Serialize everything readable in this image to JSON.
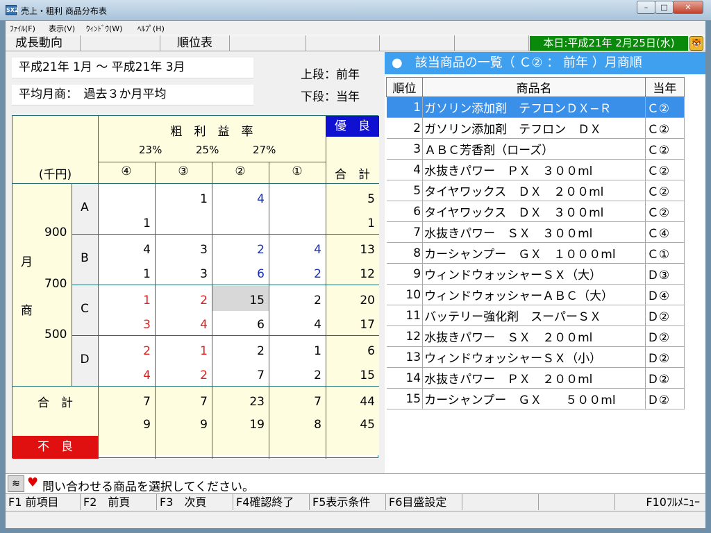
{
  "window": {
    "app_icon": "SX2",
    "title": "売上・粗利 商品分布表",
    "minimize_icon": "–",
    "maximize_icon": "□",
    "close_icon": "✕"
  },
  "menu": [
    "ﾌｧｲﾙ(F)",
    "表示(V)",
    "ｳｨﾝﾄﾞｳ(W)",
    "ﾍﾙﾌﾟ(H)"
  ],
  "toolbar": {
    "growth": "成長動向",
    "ranking": "順位表",
    "date": "本日:平成21年 2月25日(水)",
    "tiger_icon": "🐯"
  },
  "left": {
    "period": "平成21年 1月 〜 平成21年 3月",
    "avg_label": "平均月商：　過去３か月平均",
    "upper": "上段：前年",
    "lower": "下段：当年"
  },
  "matrix": {
    "title": "粗　利　益　率",
    "pcts": [
      "23%",
      "25%",
      "27%"
    ],
    "cols": [
      "④",
      "③",
      "②",
      "①"
    ],
    "unit": "(千円)",
    "excellent": "優　良",
    "total": "合　計",
    "poor": "不　良",
    "month_char": "月",
    "sales_char": "商",
    "row_totals_label": "合　計",
    "y_ticks": [
      "900",
      "700",
      "500"
    ],
    "rows": [
      {
        "label": "A",
        "cells": [
          {
            "top": "",
            "bot": "1"
          },
          {
            "top": "1",
            "bot": ""
          },
          {
            "top": "4",
            "bot": ""
          },
          {
            "top": "",
            "bot": ""
          }
        ],
        "sum": {
          "top": "5",
          "bot": "1"
        }
      },
      {
        "label": "B",
        "cells": [
          {
            "top": "4",
            "bot": "1"
          },
          {
            "top": "3",
            "bot": "3"
          },
          {
            "top": "2",
            "bot": "6"
          },
          {
            "top": "4",
            "bot": "2"
          }
        ],
        "sum": {
          "top": "13",
          "bot": "12"
        }
      },
      {
        "label": "C",
        "cells": [
          {
            "top": "1",
            "bot": "3"
          },
          {
            "top": "2",
            "bot": "4"
          },
          {
            "top": "15",
            "bot": "6"
          },
          {
            "top": "2",
            "bot": "4"
          }
        ],
        "sum": {
          "top": "20",
          "bot": "17"
        }
      },
      {
        "label": "D",
        "cells": [
          {
            "top": "2",
            "bot": "4"
          },
          {
            "top": "1",
            "bot": "2"
          },
          {
            "top": "2",
            "bot": "7"
          },
          {
            "top": "1",
            "bot": "2"
          }
        ],
        "sum": {
          "top": "6",
          "bot": "15"
        }
      }
    ],
    "col_totals": [
      {
        "top": "7",
        "bot": "9"
      },
      {
        "top": "7",
        "bot": "9"
      },
      {
        "top": "23",
        "bot": "19"
      },
      {
        "top": "7",
        "bot": "8"
      }
    ],
    "grand_total": {
      "top": "44",
      "bot": "45"
    }
  },
  "list": {
    "header": "●　該当商品の一覧（ Ｃ② ： 前年 ）月商順",
    "col_rank": "順位",
    "col_name": "商品名",
    "col_grade": "当年",
    "items": [
      {
        "rank": "1",
        "name": "ガソリン添加剤　テフロンＤＸ−Ｒ",
        "grade": "Ｃ②"
      },
      {
        "rank": "2",
        "name": "ガソリン添加剤　テフロン　ＤＸ",
        "grade": "Ｃ②"
      },
      {
        "rank": "3",
        "name": "ＡＢＣ芳香剤（ローズ）",
        "grade": "Ｃ②"
      },
      {
        "rank": "4",
        "name": "水抜きパワー　ＰＸ　３００ml",
        "grade": "Ｃ②"
      },
      {
        "rank": "5",
        "name": "タイヤワックス　ＤＸ　２００ml",
        "grade": "Ｃ②"
      },
      {
        "rank": "6",
        "name": "タイヤワックス　ＤＸ　３００ml",
        "grade": "Ｃ②"
      },
      {
        "rank": "7",
        "name": "水抜きパワー　ＳＸ　３００ml",
        "grade": "Ｃ④"
      },
      {
        "rank": "8",
        "name": "カーシャンプー　ＧＸ　１０００ml",
        "grade": "Ｃ①"
      },
      {
        "rank": "9",
        "name": "ウィンドウォッシャーＳＸ（大）",
        "grade": "Ｄ③"
      },
      {
        "rank": "10",
        "name": "ウィンドウォッシャーＡＢＣ（大）",
        "grade": "Ｄ④"
      },
      {
        "rank": "11",
        "name": "バッテリー強化剤　スーパーＳＸ",
        "grade": "Ｄ②"
      },
      {
        "rank": "12",
        "name": "水抜きパワー　ＳＸ　２００ml",
        "grade": "Ｄ②"
      },
      {
        "rank": "13",
        "name": "ウィンドウォッシャーＳＸ（小）",
        "grade": "Ｄ②"
      },
      {
        "rank": "14",
        "name": "水抜きパワー　ＰＸ　２００ml",
        "grade": "Ｄ②"
      },
      {
        "rank": "15",
        "name": "カーシャンプー　ＧＸ　　５００ml",
        "grade": "Ｄ②"
      }
    ]
  },
  "status": {
    "icon": "≋",
    "heart": "♥",
    "message": "問い合わせる商品を選択してください。"
  },
  "fkeys": [
    "F1 前項目",
    "F2　前頁",
    "F3　次頁",
    "F4確認終了",
    "F5表示条件",
    "F6目盛設定",
    "F10ﾌﾙﾒﾆｭｰ"
  ],
  "colors": {
    "accent_green": "#0a8a0a",
    "list_header_blue": "#40a0f0",
    "selected_row": "#3a8fe8",
    "excellent_blue": "#1010d0",
    "poor_red": "#e01010",
    "matrix_cream": "#fffde0"
  }
}
